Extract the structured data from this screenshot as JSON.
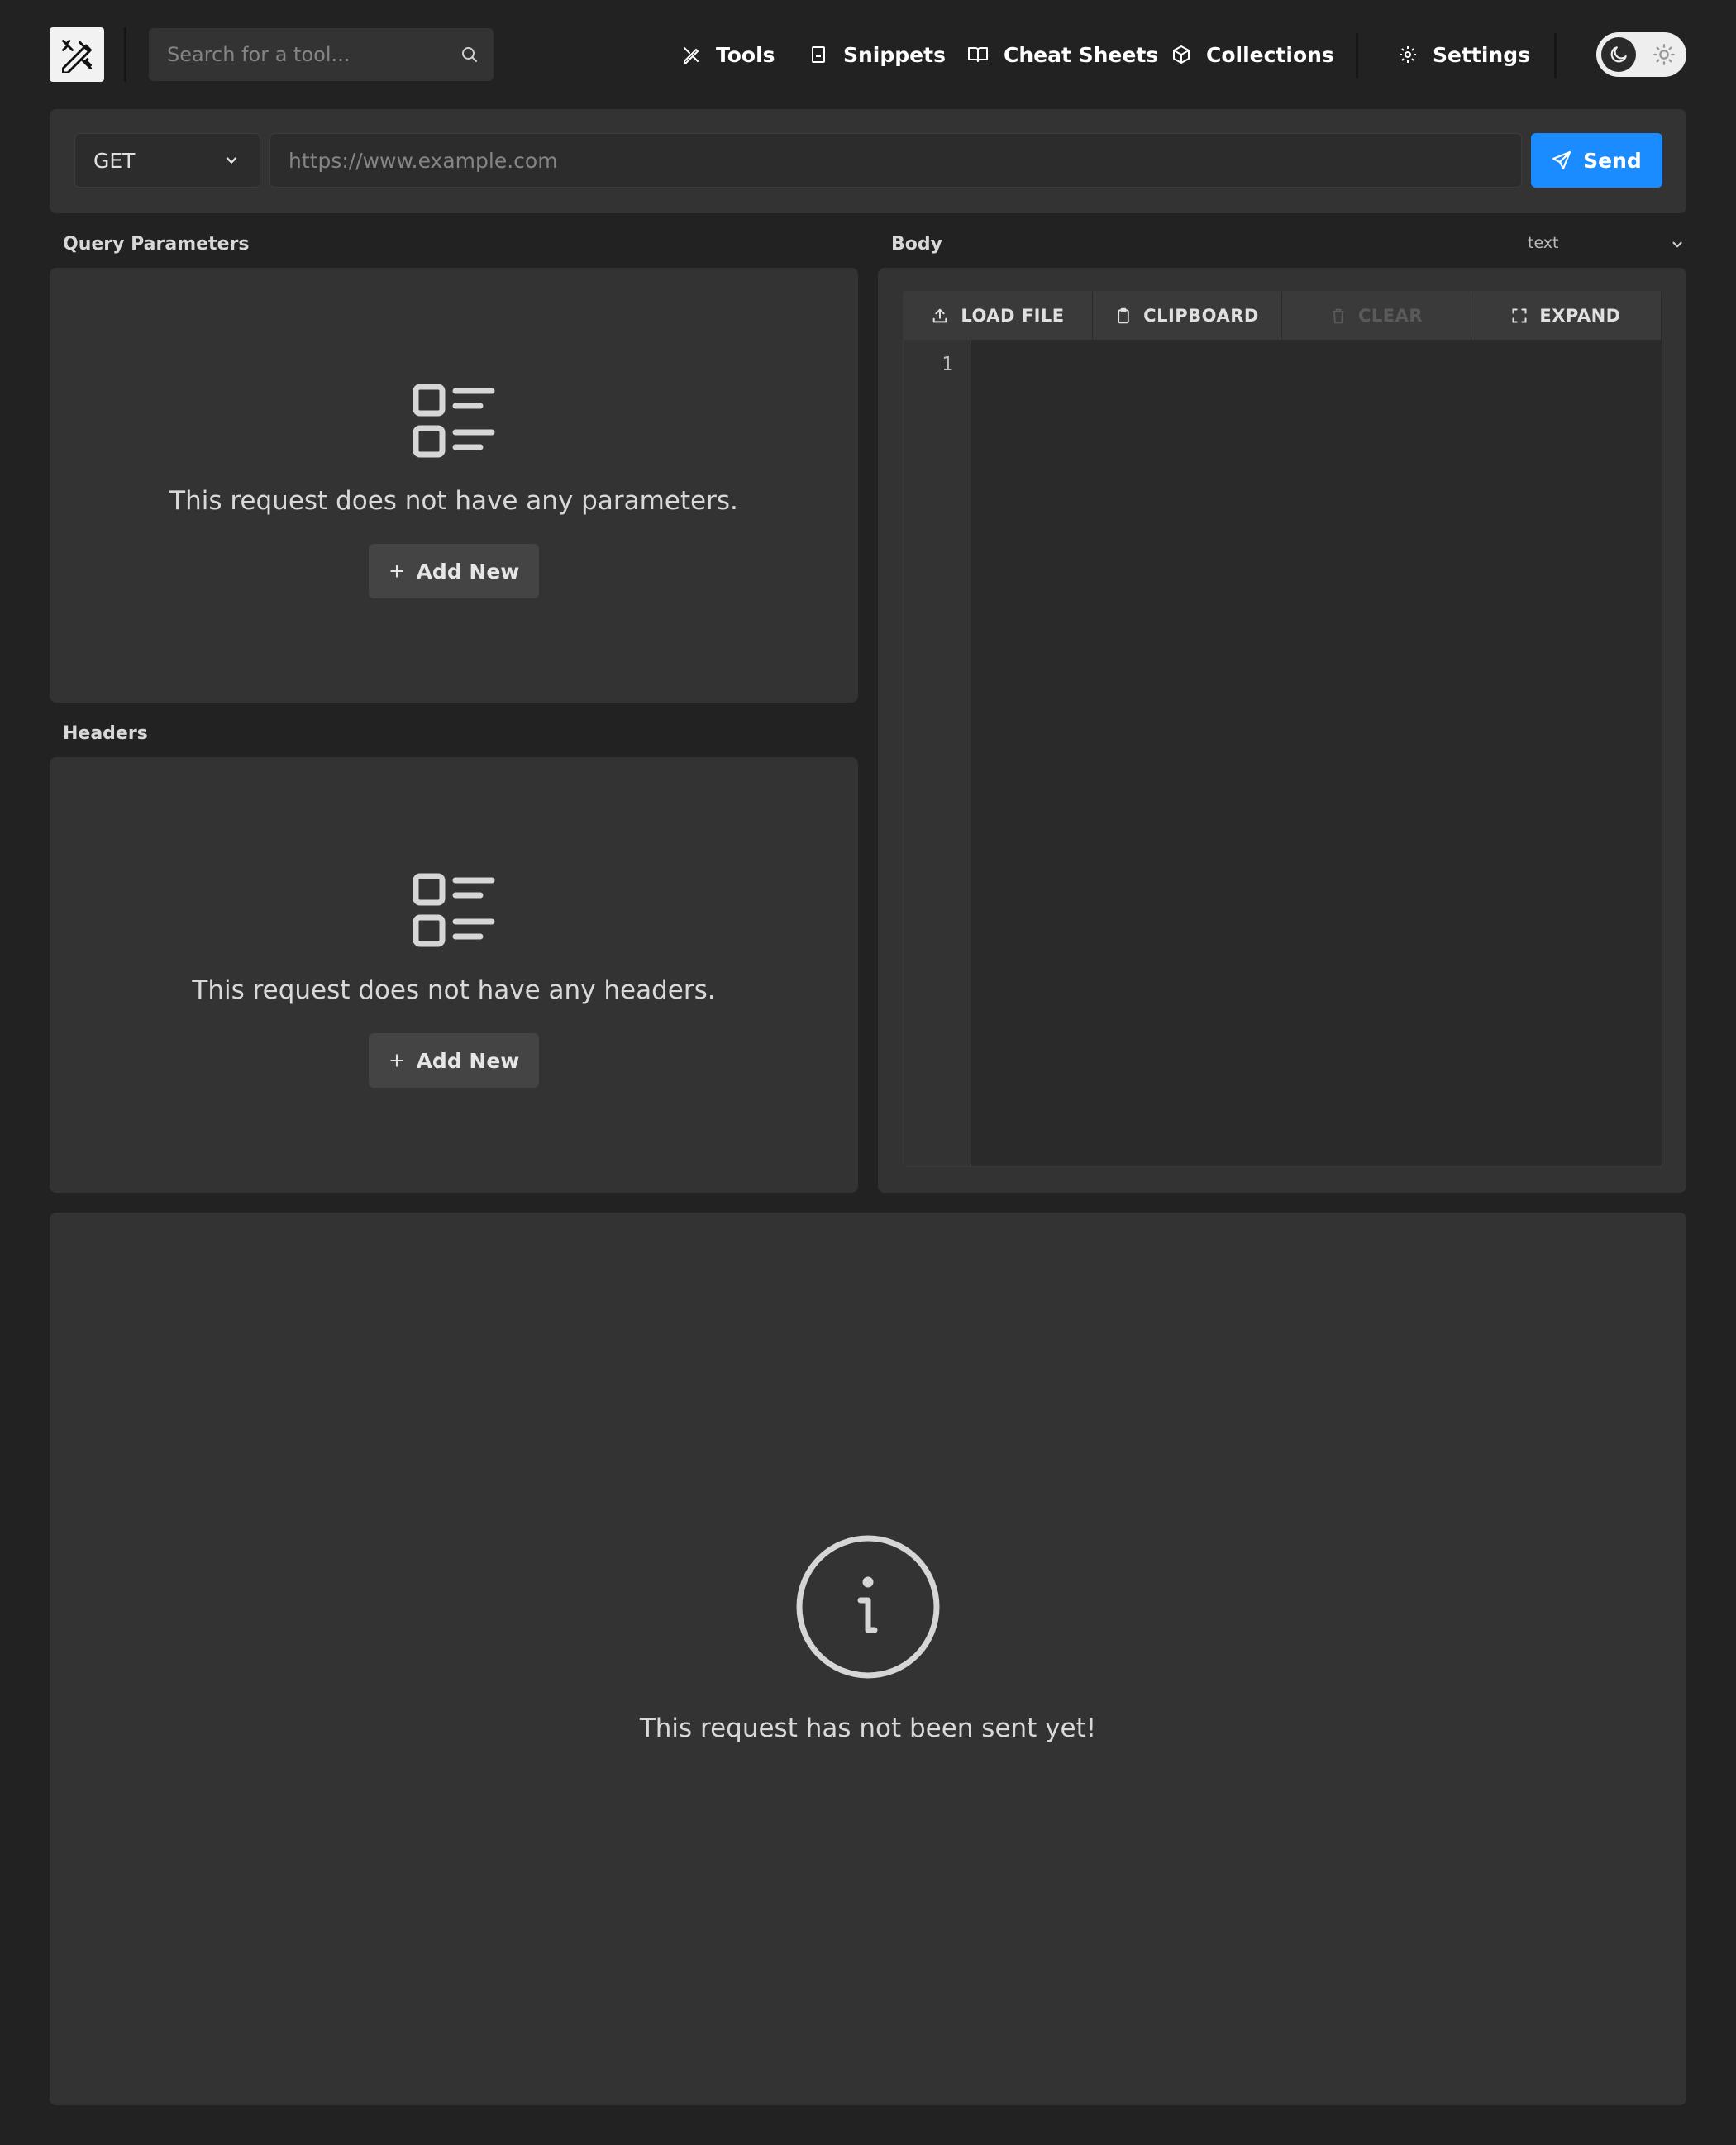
{
  "search": {
    "placeholder": "Search for a tool..."
  },
  "nav": {
    "tools": "Tools",
    "snippets": "Snippets",
    "cheat_sheets": "Cheat Sheets",
    "collections": "Collections",
    "settings": "Settings"
  },
  "request": {
    "method": "GET",
    "url_placeholder": "https://www.example.com",
    "send_label": "Send"
  },
  "query_params": {
    "title": "Query Parameters",
    "empty_message": "This request does not have any parameters.",
    "add_label": "Add New"
  },
  "headers": {
    "title": "Headers",
    "empty_message": "This request does not have any headers.",
    "add_label": "Add New"
  },
  "body": {
    "title": "Body",
    "type": "text",
    "toolbar": {
      "load_file": "LOAD FILE",
      "clipboard": "CLIPBOARD",
      "clear": "CLEAR",
      "expand": "EXPAND"
    },
    "line_number": "1"
  },
  "response": {
    "empty_message": "This request has not been sent yet!"
  },
  "colors": {
    "background": "#222222",
    "panel": "#333333",
    "accent": "#1a8cff"
  }
}
